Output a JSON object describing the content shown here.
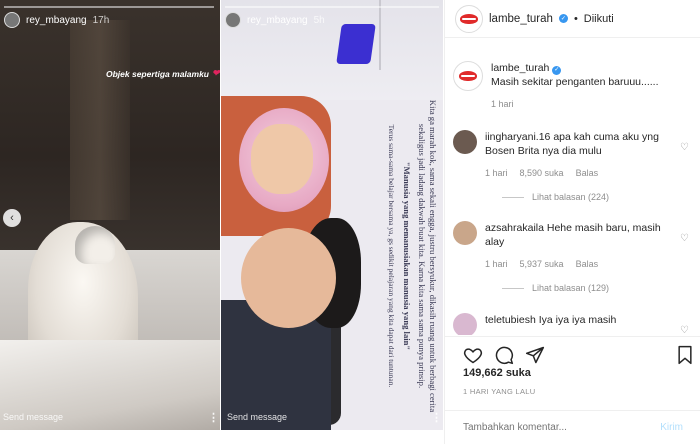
{
  "story_left": {
    "username": "rey_mbayang",
    "time": "17h",
    "sticker_text": "Objek sepertiga malamku",
    "heart_icon": "heart-icon",
    "send_message": "Send message"
  },
  "story_mid": {
    "username": "rey_mbayang",
    "time": "5h",
    "paragraph_1": "Kita ga marah kok, sama sekali engga, justru bersyukur, dikasih ruang untuk berbagi cerita sekaligus jadi ladang dakwah buat kita. Karna kita sama sama punya prinsip.",
    "paragraph_2": "\"Manusia yang memanusiakan manusia yang lain\"",
    "paragraph_3": "Terus sama-sama belajar bersama ya, gs sedikit pelajaran yang kita dapat dari tuntunan.",
    "send_message": "Send message"
  },
  "post": {
    "header": {
      "username": "lambe_turah",
      "follow_status": "Diikuti",
      "separator": "•"
    },
    "caption": {
      "username": "lambe_turah",
      "text": "Masih sekitar penganten baruuu......",
      "time": "1 hari"
    },
    "comments": [
      {
        "username": "iingharyani.16",
        "text": "apa kah cuma aku yng Bosen Brita nya dia mulu",
        "time": "1 hari",
        "likes": "8,590 suka",
        "reply": "Balas",
        "view_replies": "Lihat balasan (224)"
      },
      {
        "username": "azsahrakaila",
        "text": "Hehe masih baru, masih alay",
        "time": "1 hari",
        "likes": "5,937 suka",
        "reply": "Balas",
        "view_replies": "Lihat balasan (129)"
      },
      {
        "username": "teletubiesh",
        "text": "Iya iya iya masih",
        "time": "",
        "likes": "",
        "reply": "",
        "view_replies": ""
      }
    ],
    "likes": "149,662 suka",
    "date": "1 HARI YANG LALU",
    "comment_placeholder": "Tambahkan komentar...",
    "post_label": "Kirim"
  },
  "colors": {
    "verified": "#3897f0",
    "brand_red": "#e02a2a",
    "muted": "#8e8e8e"
  }
}
